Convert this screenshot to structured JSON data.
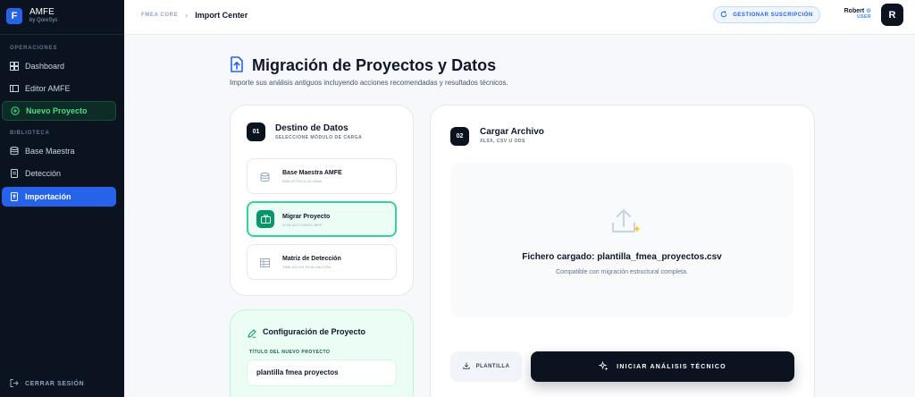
{
  "app": {
    "name": "AMFE",
    "by": "by QoreSys",
    "logo_letter": "F"
  },
  "sidebar": {
    "section_operaciones": "OPERACIONES",
    "section_biblioteca": "BIBLIOTECA",
    "items": [
      {
        "label": "Dashboard",
        "icon": "dashboard-icon"
      },
      {
        "label": "Editor AMFE",
        "icon": "editor-icon"
      },
      {
        "label": "Nuevo Proyecto",
        "icon": "plus-circle-icon"
      },
      {
        "label": "Base Maestra",
        "icon": "database-icon"
      },
      {
        "label": "Detección",
        "icon": "document-icon"
      },
      {
        "label": "Importación",
        "icon": "import-icon"
      }
    ],
    "logout": "CERRAR SESIÓN"
  },
  "topbar": {
    "crumb_root": "FMEA CORE",
    "crumb_sep": "›",
    "crumb_current": "Import Center",
    "subscription_button": "GESTIONAR SUSCRIPCIÓN",
    "user_name": "Robert",
    "user_role": "USER",
    "avatar_letter": "R"
  },
  "header": {
    "title": "Migración de Proyectos y Datos",
    "subtitle": "Importe sus análisis antiguos incluyendo acciones recomendadas y resultados técnicos."
  },
  "destino": {
    "step": "01",
    "title": "Destino de Datos",
    "subtitle": "SELECCIONE MÓDULO DE CARGA",
    "modules": [
      {
        "title": "Base Maestra AMFE",
        "sub": "BIBLIOTECA GLOBAL"
      },
      {
        "title": "Migrar Proyecto",
        "sub": "CON ACCIONES MPF"
      },
      {
        "title": "Matriz de Detección",
        "sub": "TABLAS DE EVALUACIÓN"
      }
    ]
  },
  "config": {
    "title": "Configuración de Proyecto",
    "label": "TÍTULO DEL NUEVO PROYECTO",
    "value": "plantilla fmea proyectos"
  },
  "upload": {
    "step": "02",
    "title": "Cargar Archivo",
    "subtitle": "XLSX, CSV U ODS",
    "loaded_text": "Fichero cargado: plantilla_fmea_proyectos.csv",
    "compat_text": "Compatible con migración estructural completa.",
    "template_button": "PLANTILLA",
    "run_button": "INICIAR ANÁLISIS TÉCNICO"
  },
  "colors": {
    "sidebar_bg": "#0b1220",
    "accent_blue": "#2563eb",
    "accent_green": "#059669",
    "selected_border": "#34d399"
  }
}
